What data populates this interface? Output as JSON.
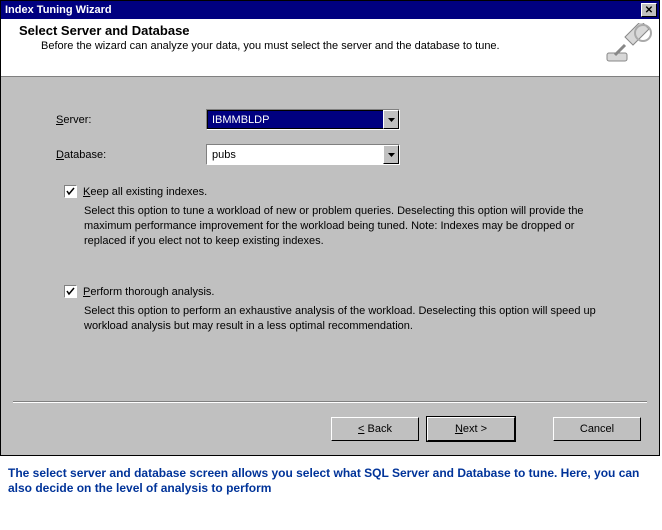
{
  "window": {
    "title": "Index Tuning Wizard"
  },
  "header": {
    "title": "Select Server and Database",
    "subtitle": "Before the wizard can analyze your data, you must select the server and the database to tune."
  },
  "form": {
    "server_label": "Server:",
    "server_value": "IBMMBLDP",
    "database_label": "Database:",
    "database_value": "pubs"
  },
  "options": {
    "keep_label": "Keep all existing indexes.",
    "keep_desc": "Select this option to tune a workload of new or problem queries. Deselecting this option will provide the maximum performance improvement for the workload being tuned. Note: Indexes may be dropped or replaced if you elect not to keep existing indexes.",
    "thorough_label": "Perform thorough analysis.",
    "thorough_desc": "Select this option to perform an exhaustive analysis of the workload. Deselecting this option will speed up workload analysis but may result in a less optimal recommendation."
  },
  "buttons": {
    "back": "< Back",
    "next": "Next >",
    "cancel": "Cancel"
  },
  "caption": "The select server and database screen allows you select what SQL Server and Database to tune. Here, you can also decide on the level of analysis to perform"
}
